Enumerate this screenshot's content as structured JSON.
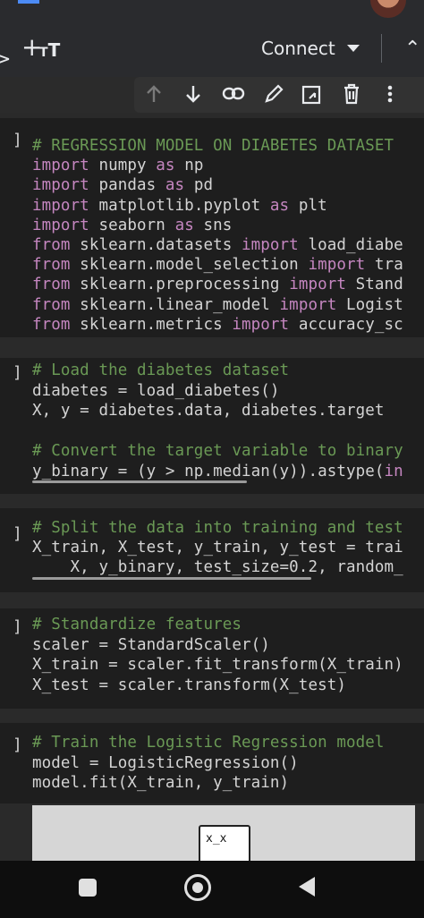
{
  "header": {
    "title": "",
    "add_code": "+",
    "text_size": {
      "small": "T",
      "big": "T"
    },
    "connect_label": "Connect"
  },
  "cells": [
    {
      "lines": [
        [
          {
            "t": "# REGRESSION MODEL ON DIABETES DATASET",
            "c": "c"
          }
        ],
        [
          {
            "t": "import",
            "c": "k"
          },
          {
            "t": " numpy "
          },
          {
            "t": "as",
            "c": "k"
          },
          {
            "t": " np"
          }
        ],
        [
          {
            "t": "import",
            "c": "k"
          },
          {
            "t": " pandas "
          },
          {
            "t": "as",
            "c": "k"
          },
          {
            "t": " pd"
          }
        ],
        [
          {
            "t": "import",
            "c": "k"
          },
          {
            "t": " matplotlib.pyplot "
          },
          {
            "t": "as",
            "c": "k"
          },
          {
            "t": " plt"
          }
        ],
        [
          {
            "t": "import",
            "c": "k"
          },
          {
            "t": " seaborn "
          },
          {
            "t": "as",
            "c": "k"
          },
          {
            "t": " sns"
          }
        ],
        [
          {
            "t": "from",
            "c": "k"
          },
          {
            "t": " sklearn.datasets "
          },
          {
            "t": "import",
            "c": "k"
          },
          {
            "t": " load_diabe"
          }
        ],
        [
          {
            "t": "from",
            "c": "k"
          },
          {
            "t": " sklearn.model_selection "
          },
          {
            "t": "import",
            "c": "k"
          },
          {
            "t": " tra"
          }
        ],
        [
          {
            "t": "from",
            "c": "k"
          },
          {
            "t": " sklearn.preprocessing "
          },
          {
            "t": "import",
            "c": "k"
          },
          {
            "t": " Stand"
          }
        ],
        [
          {
            "t": "from",
            "c": "k"
          },
          {
            "t": " sklearn.linear_model "
          },
          {
            "t": "import",
            "c": "k"
          },
          {
            "t": " Logist"
          }
        ],
        [
          {
            "t": "from",
            "c": "k"
          },
          {
            "t": " sklearn.metrics "
          },
          {
            "t": "import",
            "c": "k"
          },
          {
            "t": " accuracy_sc"
          }
        ]
      ]
    },
    {
      "lines": [
        [
          {
            "t": "# Load the diabetes dataset",
            "c": "c"
          }
        ],
        [
          {
            "t": "diabetes = load_diabetes()"
          }
        ],
        [
          {
            "t": "X, y = diabetes.data, diabetes.target"
          }
        ],
        [
          {
            "t": ""
          }
        ],
        [
          {
            "t": "# Convert the target variable to binary",
            "c": "c"
          }
        ],
        [
          {
            "t": "y_binary = (y > np.median(y)).astype("
          },
          {
            "t": "in",
            "c": "k"
          }
        ]
      ]
    },
    {
      "lines": [
        [
          {
            "t": "# Split the data into training and test",
            "c": "c"
          }
        ],
        [
          {
            "t": "X_train, X_test, y_train, y_test = trai"
          }
        ],
        [
          {
            "t": "    X, y_binary, test_size=0.2, random_"
          }
        ]
      ]
    },
    {
      "lines": [
        [
          {
            "t": "# Standardize features",
            "c": "c"
          }
        ],
        [
          {
            "t": "scaler = StandardScaler()"
          }
        ],
        [
          {
            "t": "X_train = scaler.fit_transform(X_train)"
          }
        ],
        [
          {
            "t": "X_test = scaler.transform(X_test)"
          }
        ]
      ]
    },
    {
      "lines": [
        [
          {
            "t": "# Train the Logistic Regression model",
            "c": "c"
          }
        ],
        [
          {
            "t": "model = LogisticRegression()"
          }
        ],
        [
          {
            "t": "model.fit(X_train, y_train)"
          }
        ]
      ]
    }
  ],
  "output_face": "x_x",
  "colors": {
    "keyword": "#c586c0",
    "comment": "#6a9955",
    "code": "#d4d4d4",
    "background": "#1e1e1e"
  }
}
